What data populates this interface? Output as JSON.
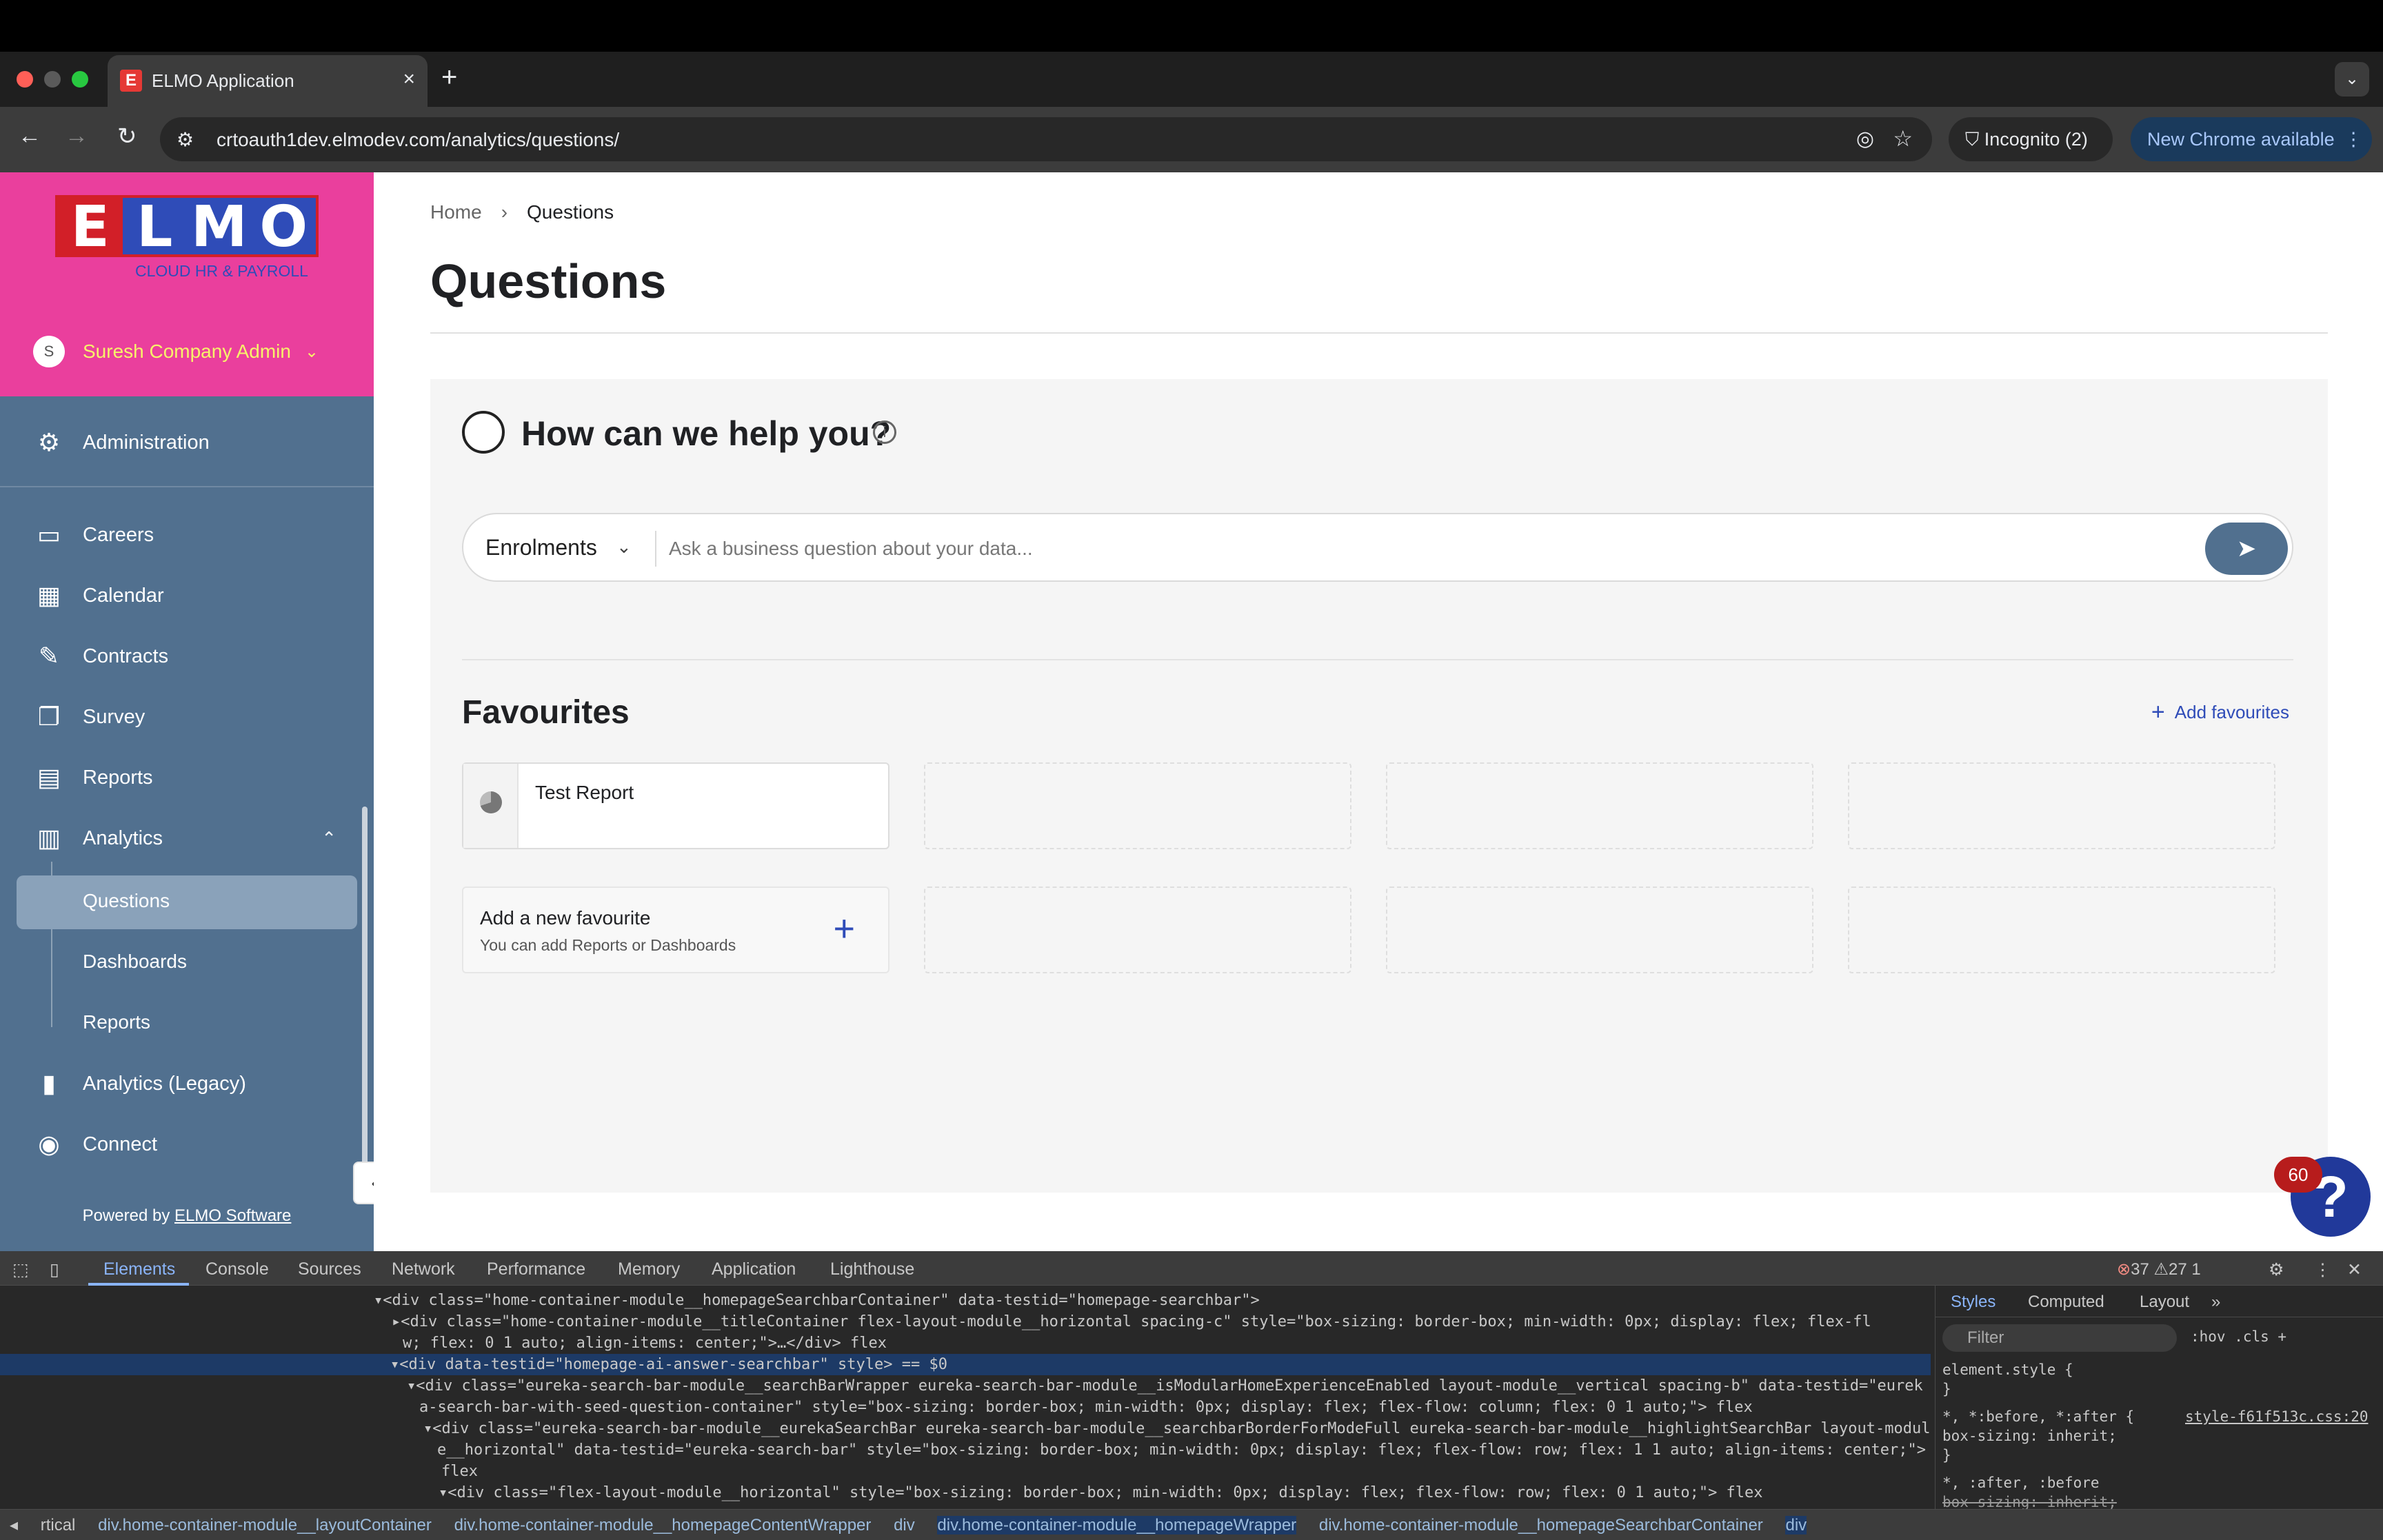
{
  "browser": {
    "tab_title": "ELMO Application",
    "tab_favicon": "E",
    "new_tab": "+",
    "url": "crtoauth1dev.elmodev.com/analytics/questions/",
    "incognito": "Incognito (2)",
    "new_chrome": "New Chrome available"
  },
  "sidebar": {
    "logo_letters": [
      "E",
      "L",
      "M",
      "O"
    ],
    "logo_tagline": "CLOUD HR & PAYROLL",
    "user_initial": "S",
    "user_name": "Suresh Company Admin",
    "items": [
      {
        "label": "Administration",
        "icon": "gear-icon"
      },
      {
        "label": "Careers",
        "icon": "briefcase-icon"
      },
      {
        "label": "Calendar",
        "icon": "calendar-icon"
      },
      {
        "label": "Contracts",
        "icon": "contract-icon"
      },
      {
        "label": "Survey",
        "icon": "survey-icon"
      },
      {
        "label": "Reports",
        "icon": "report-icon"
      },
      {
        "label": "Analytics",
        "icon": "analytics-icon"
      },
      {
        "label": "Analytics (Legacy)",
        "icon": "bar-chart-icon"
      },
      {
        "label": "Connect",
        "icon": "connect-icon"
      }
    ],
    "analytics_sub": [
      "Questions",
      "Dashboards",
      "Reports"
    ],
    "powered_by": "Powered by",
    "powered_link": "ELMO Software"
  },
  "main": {
    "breadcrumb": {
      "home": "Home",
      "current": "Questions"
    },
    "page_title": "Questions",
    "help_title": "How can we help you?",
    "scope": "Enrolments",
    "search_placeholder": "Ask a business question about your data...",
    "favourites_title": "Favourites",
    "add_favourites": "Add favourites",
    "favourite_report": "Test Report",
    "add_new_title": "Add a new favourite",
    "add_new_subtitle": "You can add Reports or Dashboards",
    "help_badge": "60"
  },
  "devtools": {
    "tabs": [
      "Elements",
      "Console",
      "Sources",
      "Network",
      "Performance",
      "Memory",
      "Application",
      "Lighthouse"
    ],
    "counts": "37 ⚠27 1",
    "styles_tabs": [
      "Styles",
      "Computed",
      "Layout"
    ],
    "filter": "Filter",
    "dom_lines": [
      "▾<div class=\"home-container-module__homepageSearchbarContainer\" data-testid=\"homepage-searchbar\">",
      "▸<div class=\"home-container-module__titleContainer flex-layout-module__horizontal spacing-c\" style=\"box-sizing: border-box; min-width: 0px; display: flex; flex-fl",
      "w; flex: 0 1 auto; align-items: center;\">…</div> flex",
      "▾<div data-testid=\"homepage-ai-answer-searchbar\" style> == $0",
      "▾<div class=\"eureka-search-bar-module__searchBarWrapper eureka-search-bar-module__isModularHomeExperienceEnabled layout-module__vertical spacing-b\" data-testid=\"eurek",
      "a-search-bar-with-seed-question-container\" style=\"box-sizing: border-box; min-width: 0px; display: flex; flex-flow: column; flex: 0 1 auto;\"> flex",
      "▾<div class=\"eureka-search-bar-module__eurekaSearchBar eureka-search-bar-module__searchbarBorderForModeFull eureka-search-bar-module__highlightSearchBar layout-modul",
      "e__horizontal\" data-testid=\"eureka-search-bar\" style=\"box-sizing: border-box; min-width: 0px; display: flex; flex-flow: row; flex: 1 1 auto; align-items: center;\">",
      "flex",
      "▾<div class=\"flex-layout-module__horizontal\" style=\"box-sizing: border-box; min-width: 0px; display: flex; flex-flow: row; flex: 0 1 auto;\"> flex"
    ],
    "css_lines": [
      "element.style {",
      "}",
      "*, *:before, *:after {",
      "  box-sizing: inherit;",
      "}",
      "*, :after, :before",
      "  box-sizing: inherit;",
      "}"
    ],
    "css_source": "style-f61f513c.css:20",
    "crumbs": [
      "rtical",
      "div.home-container-module__layoutContainer",
      "div.home-container-module__homepageContentWrapper",
      "div",
      "div.home-container-module__homepageWrapper",
      "div.home-container-module__homepageSearchbarContainer",
      "div"
    ]
  },
  "colors": {
    "brand_pink": "#ea3f9d",
    "sidebar": "#51708f",
    "link_blue": "#2f4cb8",
    "help_fab": "#21399a"
  }
}
